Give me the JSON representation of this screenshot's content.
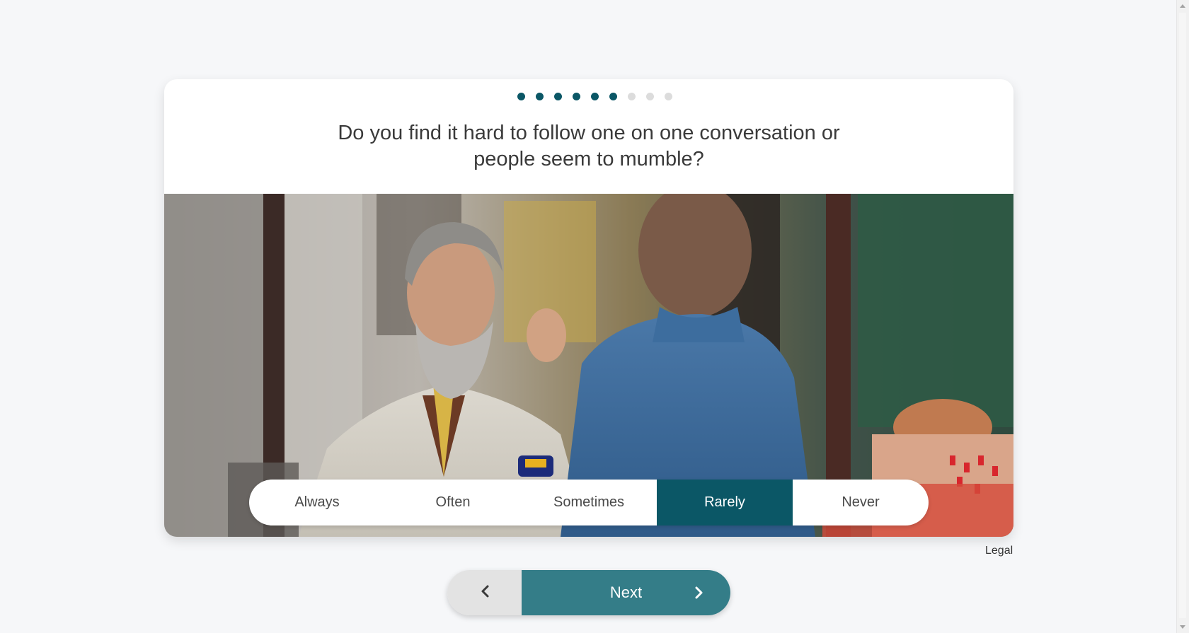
{
  "progress": {
    "total_steps": 9,
    "completed_steps": 6
  },
  "question": {
    "text": "Do you find it hard to follow one on one conversation or people seem to mumble?"
  },
  "answers": {
    "options": [
      "Always",
      "Often",
      "Sometimes",
      "Rarely",
      "Never"
    ],
    "selected": "Rarely"
  },
  "footer": {
    "legal_label": "Legal"
  },
  "navigation": {
    "next_label": "Next"
  },
  "icons": {
    "back": "chevron-left-icon",
    "next": "chevron-right-icon"
  },
  "colors": {
    "accent": "#0b5766",
    "next_button": "#347d88",
    "back_button": "#e3e3e3",
    "dot_pending": "#dcdcdc"
  }
}
